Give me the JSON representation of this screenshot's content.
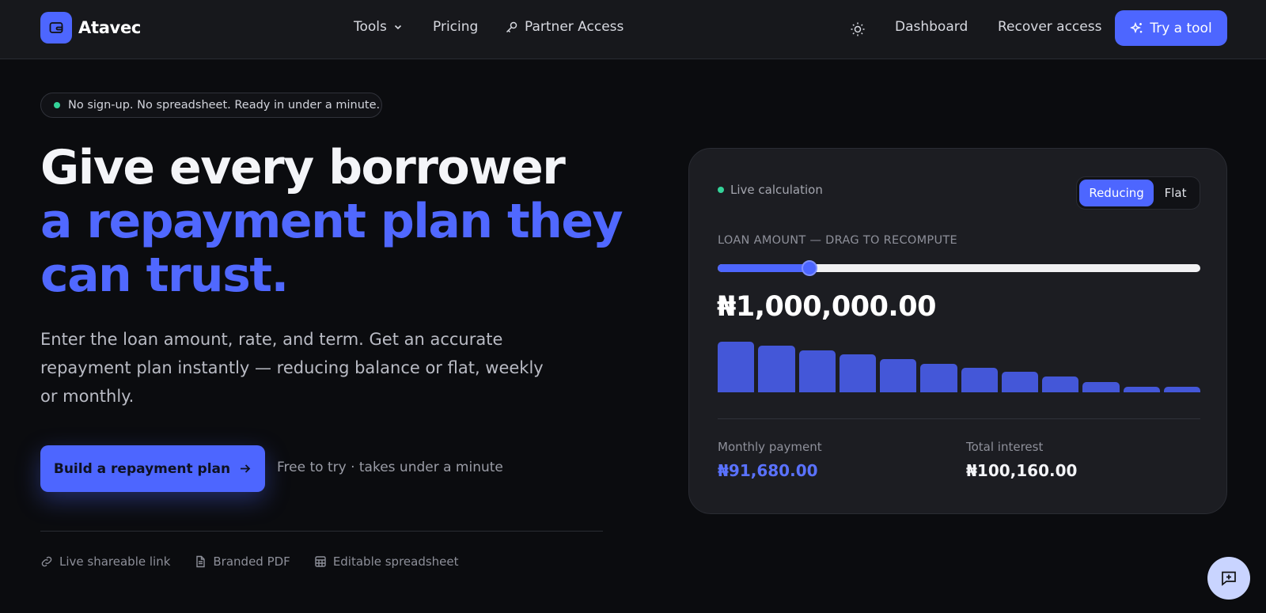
{
  "nav": {
    "brand": "Atavec",
    "links": {
      "tools": "Tools",
      "pricing": "Pricing",
      "partner": "Partner Access",
      "dashboard": "Dashboard",
      "recover": "Recover access"
    },
    "cta": "Try a tool"
  },
  "hero": {
    "pill": "No sign-up. No spreadsheet. Ready in under a minute.",
    "headline_line1": "Give every borrower",
    "headline_line2": "a repayment plan they",
    "headline_line3": "can trust.",
    "subtext": "Enter the loan amount, rate, and term. Get an accurate repayment plan instantly — reducing balance or flat, weekly or monthly.",
    "cta": "Build a repayment plan",
    "cta_note": "Free to try · takes under a minute",
    "features": [
      "Live shareable link",
      "Branded PDF",
      "Editable spreadsheet"
    ]
  },
  "calculator": {
    "live_label": "Live calculation",
    "modes": [
      "Reducing",
      "Flat"
    ],
    "active_mode": "Reducing",
    "loan_label": "LOAN AMOUNT — DRAG TO RECOMPUTE",
    "slider_fraction": 0.19,
    "amount": "₦1,000,000.00",
    "bar_levels": [
      1.0,
      0.92,
      0.83,
      0.75,
      0.66,
      0.57,
      0.49,
      0.4,
      0.31,
      0.2,
      0.11,
      0.11
    ],
    "monthly_label": "Monthly payment",
    "monthly_value": "₦91,680.00",
    "interest_label": "Total interest",
    "interest_value": "₦100,160.00"
  },
  "colors": {
    "accent": "#4d66ff",
    "live_dot": "#34d399",
    "background": "#0b0c0f",
    "card": "#1c1d22"
  },
  "icons": {
    "brand": "wallet-icon",
    "tools": "chevron-down-icon",
    "partner": "key-icon",
    "theme": "sun-icon",
    "cta": "sparkles-icon",
    "arrow": "arrow-right-icon",
    "features": [
      "link-icon",
      "document-icon",
      "table-icon"
    ],
    "help": "message-plus-icon"
  }
}
